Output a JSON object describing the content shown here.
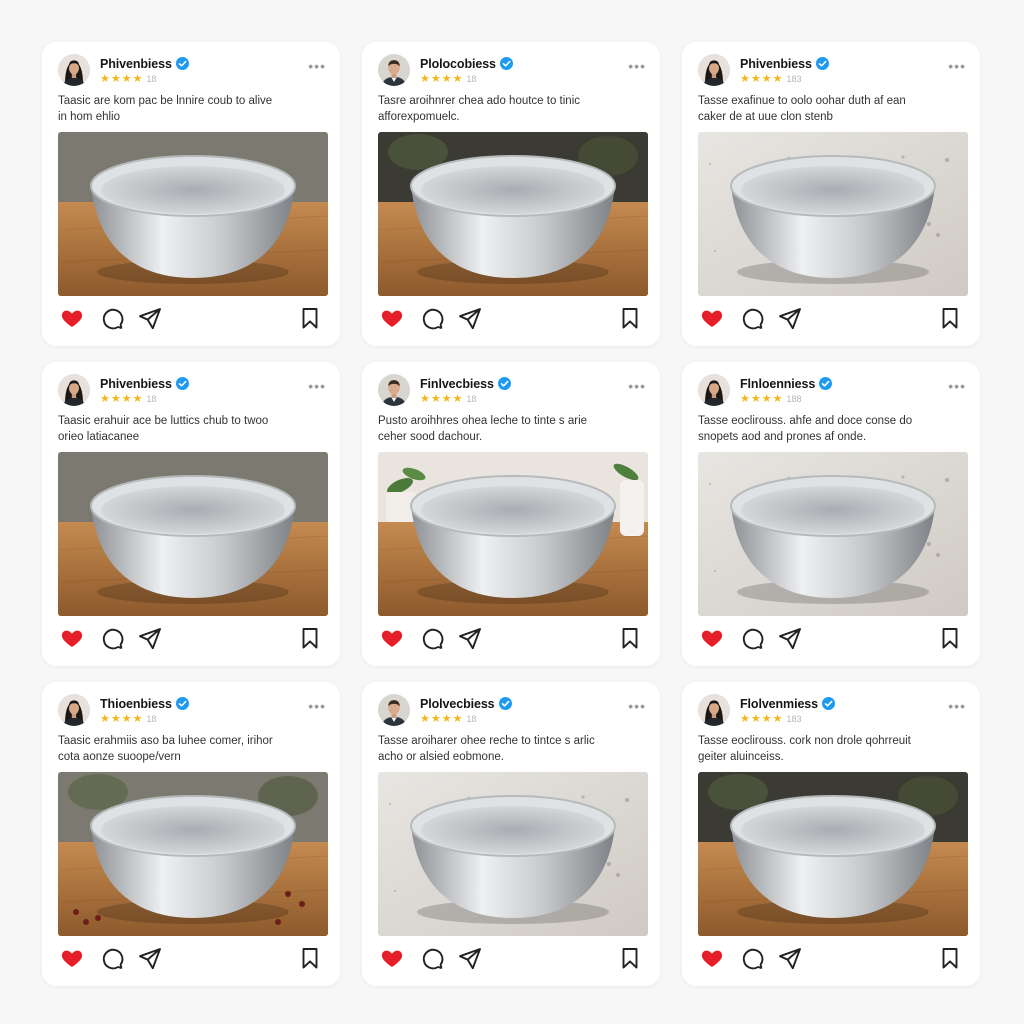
{
  "feed": {
    "posts": [
      {
        "username": "Phivenbiess",
        "rating": 4,
        "count": "18",
        "caption_line1": "Taasic are kom pac be lnnire coub to alive",
        "caption_line2": "in hom ehlio",
        "photo_scene": "wood",
        "avatar": "woman"
      },
      {
        "username": "Plolocobiess",
        "rating": 4,
        "count": "18",
        "caption_line1": "Tasre aroihnrer chea ado houtce to tinic",
        "caption_line2": "afforexpomuelc.",
        "photo_scene": "wood-dark",
        "avatar": "man"
      },
      {
        "username": "Phivenbiess",
        "rating": 4,
        "count": "183",
        "caption_line1": "Tasse exafinue to oolo oohar duth af ean",
        "caption_line2": "caker de at uue clon stenb",
        "photo_scene": "granite",
        "avatar": "woman"
      },
      {
        "username": "Phivenbiess",
        "rating": 4,
        "count": "18",
        "caption_line1": "Taasic erahuir ace be luttics chub to twoo",
        "caption_line2": "orieo latiacanee",
        "photo_scene": "wood",
        "avatar": "woman"
      },
      {
        "username": "Finlvecbiess",
        "rating": 4,
        "count": "18",
        "caption_line1": "Pusto aroihhres ohea leche to tinte s arie",
        "caption_line2": "ceher sood dachour.",
        "photo_scene": "wood-plant",
        "avatar": "man"
      },
      {
        "username": "Flnloenniess",
        "rating": 4,
        "count": "188",
        "caption_line1": "Tasse eoclirouss. ahfe and doce conse do",
        "caption_line2": "snopets aod and prones af onde.",
        "photo_scene": "granite",
        "avatar": "woman"
      },
      {
        "username": "Thioenbiess",
        "rating": 4,
        "count": "18",
        "caption_line1": "Taasic erahmiis aso ba luhee comer, irihor",
        "caption_line2": "cota aonze suoope/vern",
        "photo_scene": "wood-berries",
        "avatar": "woman"
      },
      {
        "username": "Plolvecbiess",
        "rating": 4,
        "count": "18",
        "caption_line1": "Tasse aroiharer ohee reche to tintce s arlic",
        "caption_line2": "acho or alsied eobmone.",
        "photo_scene": "granite",
        "avatar": "man"
      },
      {
        "username": "Flolvenmiess",
        "rating": 4,
        "count": "183",
        "caption_line1": "Tasse eoclirouss. cork non drole qohrreuit",
        "caption_line2": "geiter aluinceiss.",
        "photo_scene": "wood-dark",
        "avatar": "woman"
      }
    ]
  },
  "colors": {
    "accent_verified": "#1d9bf0",
    "like_heart": "#e51e2a",
    "star": "#f2b619"
  },
  "icons": [
    "heart-icon",
    "comment-icon",
    "share-icon",
    "bookmark-icon",
    "more-icon",
    "verified-icon",
    "star-icon"
  ]
}
